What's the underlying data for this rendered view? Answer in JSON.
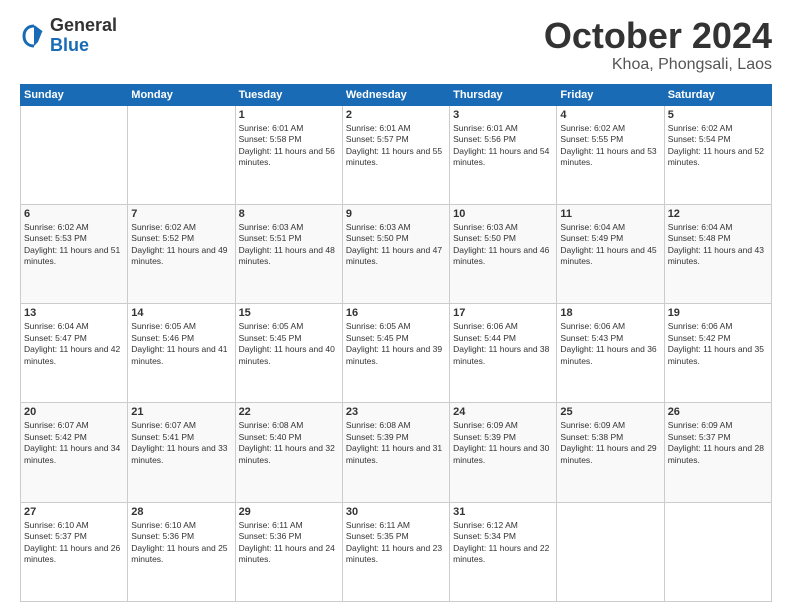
{
  "header": {
    "logo_general": "General",
    "logo_blue": "Blue",
    "month_title": "October 2024",
    "subtitle": "Khoa, Phongsali, Laos"
  },
  "days_of_week": [
    "Sunday",
    "Monday",
    "Tuesday",
    "Wednesday",
    "Thursday",
    "Friday",
    "Saturday"
  ],
  "weeks": [
    [
      {
        "day": "",
        "info": ""
      },
      {
        "day": "",
        "info": ""
      },
      {
        "day": "1",
        "info": "Sunrise: 6:01 AM\nSunset: 5:58 PM\nDaylight: 11 hours and 56 minutes."
      },
      {
        "day": "2",
        "info": "Sunrise: 6:01 AM\nSunset: 5:57 PM\nDaylight: 11 hours and 55 minutes."
      },
      {
        "day": "3",
        "info": "Sunrise: 6:01 AM\nSunset: 5:56 PM\nDaylight: 11 hours and 54 minutes."
      },
      {
        "day": "4",
        "info": "Sunrise: 6:02 AM\nSunset: 5:55 PM\nDaylight: 11 hours and 53 minutes."
      },
      {
        "day": "5",
        "info": "Sunrise: 6:02 AM\nSunset: 5:54 PM\nDaylight: 11 hours and 52 minutes."
      }
    ],
    [
      {
        "day": "6",
        "info": "Sunrise: 6:02 AM\nSunset: 5:53 PM\nDaylight: 11 hours and 51 minutes."
      },
      {
        "day": "7",
        "info": "Sunrise: 6:02 AM\nSunset: 5:52 PM\nDaylight: 11 hours and 49 minutes."
      },
      {
        "day": "8",
        "info": "Sunrise: 6:03 AM\nSunset: 5:51 PM\nDaylight: 11 hours and 48 minutes."
      },
      {
        "day": "9",
        "info": "Sunrise: 6:03 AM\nSunset: 5:50 PM\nDaylight: 11 hours and 47 minutes."
      },
      {
        "day": "10",
        "info": "Sunrise: 6:03 AM\nSunset: 5:50 PM\nDaylight: 11 hours and 46 minutes."
      },
      {
        "day": "11",
        "info": "Sunrise: 6:04 AM\nSunset: 5:49 PM\nDaylight: 11 hours and 45 minutes."
      },
      {
        "day": "12",
        "info": "Sunrise: 6:04 AM\nSunset: 5:48 PM\nDaylight: 11 hours and 43 minutes."
      }
    ],
    [
      {
        "day": "13",
        "info": "Sunrise: 6:04 AM\nSunset: 5:47 PM\nDaylight: 11 hours and 42 minutes."
      },
      {
        "day": "14",
        "info": "Sunrise: 6:05 AM\nSunset: 5:46 PM\nDaylight: 11 hours and 41 minutes."
      },
      {
        "day": "15",
        "info": "Sunrise: 6:05 AM\nSunset: 5:45 PM\nDaylight: 11 hours and 40 minutes."
      },
      {
        "day": "16",
        "info": "Sunrise: 6:05 AM\nSunset: 5:45 PM\nDaylight: 11 hours and 39 minutes."
      },
      {
        "day": "17",
        "info": "Sunrise: 6:06 AM\nSunset: 5:44 PM\nDaylight: 11 hours and 38 minutes."
      },
      {
        "day": "18",
        "info": "Sunrise: 6:06 AM\nSunset: 5:43 PM\nDaylight: 11 hours and 36 minutes."
      },
      {
        "day": "19",
        "info": "Sunrise: 6:06 AM\nSunset: 5:42 PM\nDaylight: 11 hours and 35 minutes."
      }
    ],
    [
      {
        "day": "20",
        "info": "Sunrise: 6:07 AM\nSunset: 5:42 PM\nDaylight: 11 hours and 34 minutes."
      },
      {
        "day": "21",
        "info": "Sunrise: 6:07 AM\nSunset: 5:41 PM\nDaylight: 11 hours and 33 minutes."
      },
      {
        "day": "22",
        "info": "Sunrise: 6:08 AM\nSunset: 5:40 PM\nDaylight: 11 hours and 32 minutes."
      },
      {
        "day": "23",
        "info": "Sunrise: 6:08 AM\nSunset: 5:39 PM\nDaylight: 11 hours and 31 minutes."
      },
      {
        "day": "24",
        "info": "Sunrise: 6:09 AM\nSunset: 5:39 PM\nDaylight: 11 hours and 30 minutes."
      },
      {
        "day": "25",
        "info": "Sunrise: 6:09 AM\nSunset: 5:38 PM\nDaylight: 11 hours and 29 minutes."
      },
      {
        "day": "26",
        "info": "Sunrise: 6:09 AM\nSunset: 5:37 PM\nDaylight: 11 hours and 28 minutes."
      }
    ],
    [
      {
        "day": "27",
        "info": "Sunrise: 6:10 AM\nSunset: 5:37 PM\nDaylight: 11 hours and 26 minutes."
      },
      {
        "day": "28",
        "info": "Sunrise: 6:10 AM\nSunset: 5:36 PM\nDaylight: 11 hours and 25 minutes."
      },
      {
        "day": "29",
        "info": "Sunrise: 6:11 AM\nSunset: 5:36 PM\nDaylight: 11 hours and 24 minutes."
      },
      {
        "day": "30",
        "info": "Sunrise: 6:11 AM\nSunset: 5:35 PM\nDaylight: 11 hours and 23 minutes."
      },
      {
        "day": "31",
        "info": "Sunrise: 6:12 AM\nSunset: 5:34 PM\nDaylight: 11 hours and 22 minutes."
      },
      {
        "day": "",
        "info": ""
      },
      {
        "day": "",
        "info": ""
      }
    ]
  ]
}
